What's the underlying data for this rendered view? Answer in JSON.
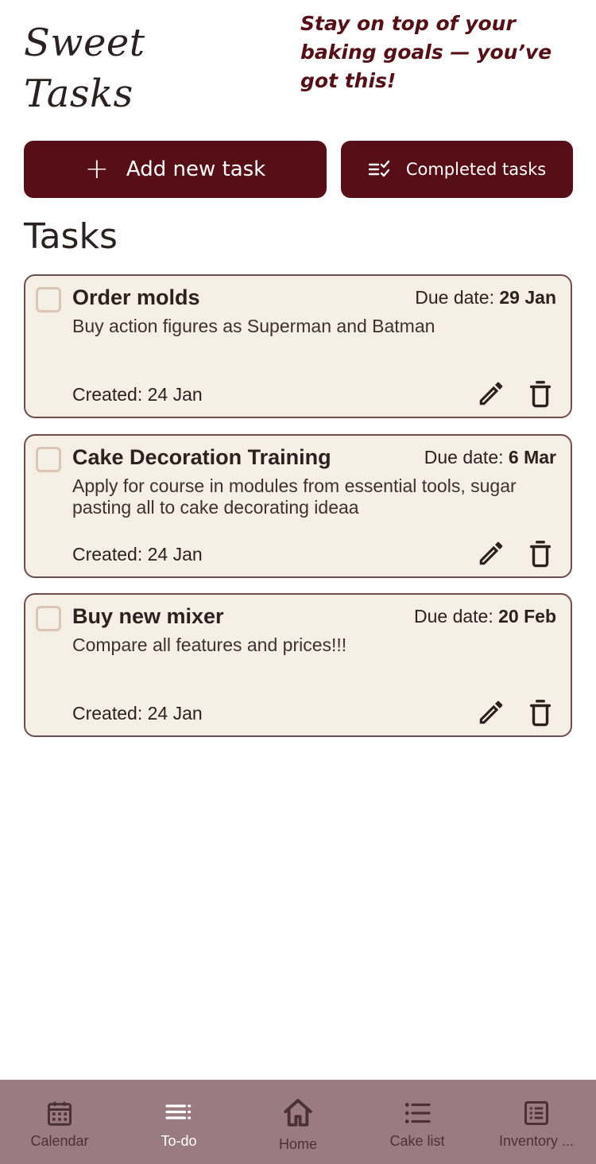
{
  "header": {
    "title_line1": "Sweet",
    "title_line2": "Tasks",
    "tagline": "Stay on top of your baking goals — you’ve got this!"
  },
  "actions": {
    "add_label": "Add new task",
    "add_icon": "plus-icon",
    "completed_label": "Completed tasks",
    "completed_icon": "checklist-icon"
  },
  "section": {
    "title": "Tasks"
  },
  "tasks": [
    {
      "title": "Order molds",
      "due_prefix": "Due date:",
      "due_date": "29 Jan",
      "description": "Buy action figures as Superman and Batman",
      "created": "Created: 24 Jan",
      "checked": false
    },
    {
      "title": "Cake Decoration Training",
      "due_prefix": "Due date:",
      "due_date": "6 Mar",
      "description": "Apply for course in modules from essential tools, sugar pasting all to cake decorating ideaa",
      "created": "Created: 24 Jan",
      "checked": false
    },
    {
      "title": "Buy new mixer",
      "due_prefix": "Due date:",
      "due_date": "20 Feb",
      "description": "Compare all features and prices!!!",
      "created": "Created: 24 Jan",
      "checked": false
    }
  ],
  "nav": {
    "items": [
      {
        "label": "Calendar",
        "icon": "calendar-icon",
        "active": false
      },
      {
        "label": "To-do",
        "icon": "list-icon",
        "active": true
      },
      {
        "label": "Home",
        "icon": "home-icon",
        "active": false
      },
      {
        "label": "Cake list",
        "icon": "bullet-list-icon",
        "active": false
      },
      {
        "label": "Inventory ...",
        "icon": "document-list-icon",
        "active": false
      }
    ]
  },
  "colors": {
    "primary": "#560f17",
    "card_bg": "#f5efe6",
    "card_border": "#6d4e4e",
    "nav_bg": "#9b7b82",
    "checkbox_border": "#dbc6b5"
  }
}
